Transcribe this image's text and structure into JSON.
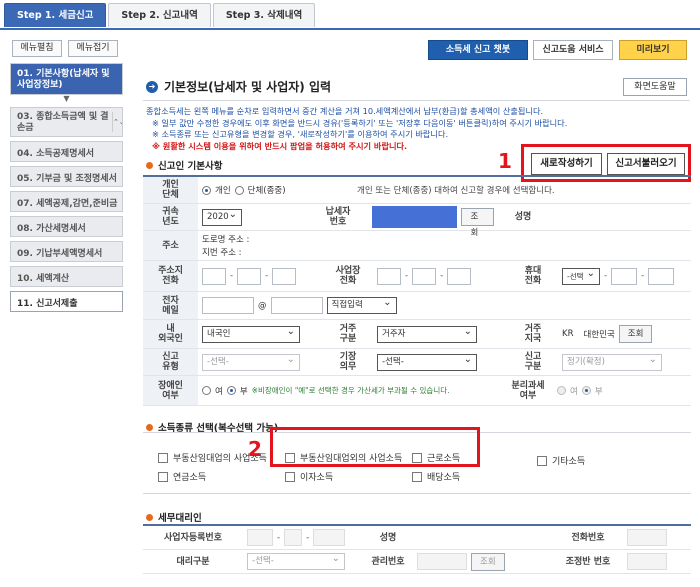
{
  "tabs": [
    "Step 1. 세금신고",
    "Step 2. 신고내역",
    "Step 3. 삭제내역"
  ],
  "sidebar": {
    "open_all": "메뉴펼침",
    "close_all": "메뉴접기",
    "items": [
      {
        "label": "01. 기본사항(납세자 및 사업장정보)"
      },
      {
        "label": "03. 종합소득금액 및 결손금"
      },
      {
        "label": "04. 소득공제명세서"
      },
      {
        "label": "05. 기부금 및 조정명세서"
      },
      {
        "label": "07. 세액공제,감면,준비금"
      },
      {
        "label": "08. 가산세명세서"
      },
      {
        "label": "09. 기납부세액명세서"
      },
      {
        "label": "10. 세액계산"
      },
      {
        "label": "11. 신고서제출"
      }
    ]
  },
  "services": {
    "chatbot": "소득세 신고 챗봇",
    "help_service": "신고도움 서비스",
    "preview": "미리보기"
  },
  "page": {
    "title": "기본정보(납세자 및 사업자) 입력",
    "help": "화면도움말"
  },
  "notice": {
    "line1": "종합소득세는 왼쪽 메뉴를 순차로 입력하면서 중간 계산을 거쳐 10.세액계산에서 납부(환급)할 총세액이 산출됩니다.",
    "line2": "※ 일부 값만 수정한 경우에도 이후 화면을 반드시 경유('등록하기' 또는 '저장후 다음이동' 버튼클릭)하여 주시기 바랍니다.",
    "line3": "※ 소득종류 또는 신고유형을 변경할 경우, '새로작성하기'를 이용하여 주시기 바랍니다.",
    "line4": "※ 원활한 시스템 이용을 위하여 반드시 팝업을 허용하여 주시기 바랍니다."
  },
  "sections": {
    "basic": "신고인 기본사항",
    "income_type": "소득종류 선택(복수선택 가능)",
    "agent": "세무대리인"
  },
  "actions": {
    "new": "새로작성하기",
    "load": "신고서불러오기"
  },
  "annotations": {
    "n1": "1",
    "n2": "2"
  },
  "form": {
    "person_type_label": "개인\n단체",
    "person_option": "개인",
    "group_option": "단체(종중)",
    "person_hint": "개인 또는 단체(종중) 대하여 신고할 경우에 선택합니다.",
    "year_label": "귀속\n년도",
    "year_value": "2020",
    "taxpayer_no_label": "납세자\n번호",
    "lookup": "조회",
    "name_label": "성명",
    "address_label": "주소",
    "road_address": "도로명 주소 :",
    "lot_address": "지번 주소 :",
    "home_phone_label": "주소지\n전화",
    "biz_phone_label": "사업장\n전화",
    "mobile_label": "휴대\n전화",
    "mobile_prefix": "-선택",
    "email_label": "전자\n메일",
    "email_at": "@",
    "email_direct": "직접입력",
    "nationality_label": "내\n외국인",
    "nationality_value": "내국인",
    "residence_label": "거주\n구분",
    "residence_value": "거주자",
    "country_label": "거주\n지국",
    "country_code": "KR",
    "country_name": "대한민국",
    "report_type_label": "신고\n유형",
    "select_placeholder": "-선택-",
    "bookkeeping_label": "기장\n의무",
    "report_category_label": "신고\n구분",
    "report_category_value": "정기(확정)",
    "disabled_label": "장애인\n여부",
    "yes": "여",
    "no": "부",
    "disabled_note": "※비장애인이 \"예\"로 선택한 경우 가산세가 부과될 수 있습니다.",
    "separate_tax_label": "분리과세\n여부"
  },
  "income_types": {
    "item1": "부동산임대업의 사업소득",
    "item2": "부동산임대업외의 사업소득",
    "item3": "근로소득",
    "item4": "기타소득",
    "item5": "연금소득",
    "item6": "이자소득",
    "item7": "배당소득"
  },
  "agent": {
    "reg_no_label": "사업자등록번호",
    "name_label": "성명",
    "phone_label": "전화번호",
    "type_label": "대리구분",
    "type_value": "-선택-",
    "mgmt_label": "관리번호",
    "lookup": "조회",
    "team_label": "조정반 번호"
  }
}
